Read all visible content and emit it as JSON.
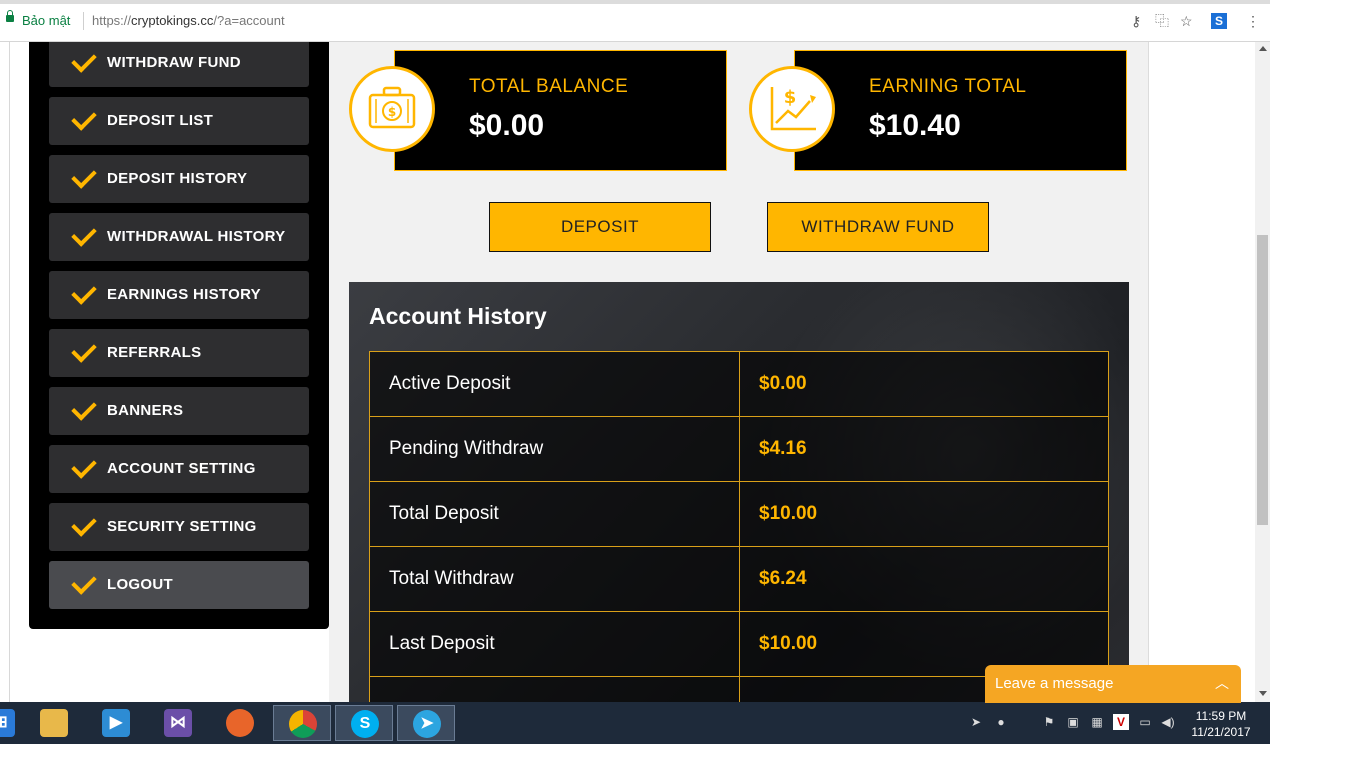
{
  "browser": {
    "secure_label": "Bảo mật",
    "url_prefix": "https://",
    "url_host": "cryptokings.cc",
    "url_path": "/?a=account"
  },
  "sidebar": {
    "items": [
      {
        "label": "WITHDRAW FUND"
      },
      {
        "label": "DEPOSIT LIST"
      },
      {
        "label": "DEPOSIT HISTORY"
      },
      {
        "label": "WITHDRAWAL HISTORY"
      },
      {
        "label": "EARNINGS HISTORY"
      },
      {
        "label": "REFERRALS"
      },
      {
        "label": "BANNERS"
      },
      {
        "label": "ACCOUNT SETTING"
      },
      {
        "label": "SECURITY SETTING"
      },
      {
        "label": "LOGOUT"
      }
    ]
  },
  "cards": {
    "balance": {
      "title": "TOTAL BALANCE",
      "value": "$0.00"
    },
    "earning": {
      "title": "EARNING TOTAL",
      "value": "$10.40"
    }
  },
  "buttons": {
    "deposit": "DEPOSIT",
    "withdraw": "WITHDRAW FUND"
  },
  "history": {
    "title": "Account History",
    "rows": [
      {
        "label": "Active Deposit",
        "value": "$0.00"
      },
      {
        "label": "Pending Withdraw",
        "value": "$4.16"
      },
      {
        "label": "Total Deposit",
        "value": "$10.00"
      },
      {
        "label": "Total Withdraw",
        "value": "$6.24"
      },
      {
        "label": "Last Deposit",
        "value": "$10.00"
      }
    ]
  },
  "chat": {
    "label": "Leave a message"
  },
  "taskbar": {
    "time": "11:59 PM",
    "date": "11/21/2017"
  },
  "colors": {
    "accent": "#ffb600",
    "sidebar_bg": "#000000",
    "item_bg": "#2e2e30",
    "chat": "#f5a623"
  }
}
